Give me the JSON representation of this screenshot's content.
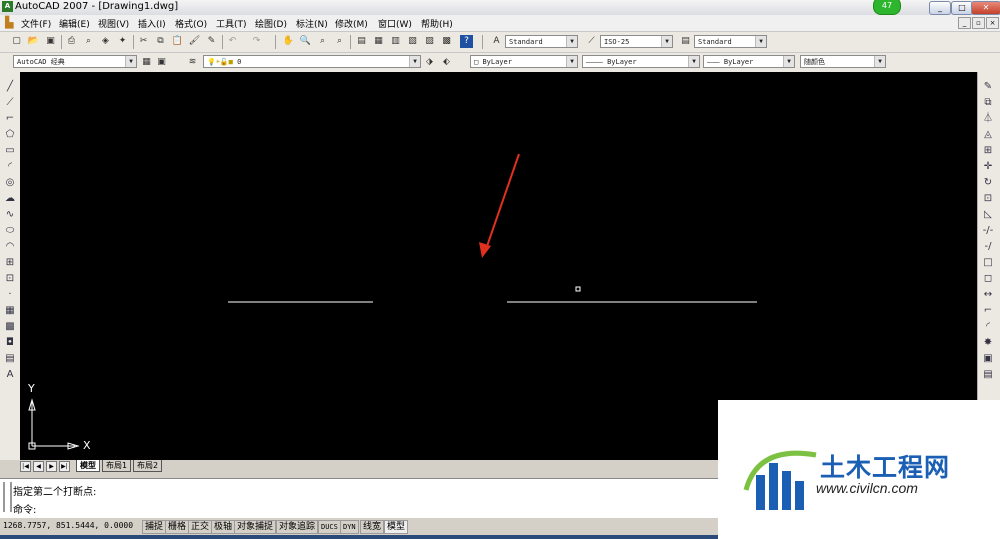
{
  "window": {
    "title": "AutoCAD 2007 - [Drawing1.dwg]",
    "app_icon_label": "A",
    "badge": "47",
    "controls": [
      "_",
      "□",
      "✕"
    ],
    "mdi_controls": [
      "_",
      "▫",
      "×"
    ]
  },
  "menu": [
    "文件(F)",
    "编辑(E)",
    "视图(V)",
    "插入(I)",
    "格式(O)",
    "工具(T)",
    "绘图(D)",
    "标注(N)",
    "修改(M)",
    "窗口(W)",
    "帮助(H)"
  ],
  "toolbar1": {
    "text_style": "Standard",
    "dim_style": "ISO-25",
    "table_style": "Standard"
  },
  "toolbar2": {
    "workspace": "AutoCAD 经典",
    "layer": "0",
    "color": "ByLayer",
    "linetype": "ByLayer",
    "lineweight": "ByLayer",
    "plotstyle": "随颜色"
  },
  "left_tools": [
    "line-icon",
    "construction-line-icon",
    "polyline-icon",
    "polygon-icon",
    "rectangle-icon",
    "arc-icon",
    "circle-icon",
    "revision-cloud-icon",
    "spline-icon",
    "ellipse-icon",
    "ellipse-arc-icon",
    "insert-block-icon",
    "make-block-icon",
    "point-icon",
    "hatch-icon",
    "gradient-icon",
    "region-icon",
    "table-icon",
    "multiline-text-icon"
  ],
  "left_tool_glyphs": [
    "╱",
    "⟋",
    "⌐",
    "⬠",
    "▭",
    "◜",
    "◎",
    "☁",
    "∿",
    "⬭",
    "◠",
    "⊞",
    "⊡",
    "·",
    "▦",
    "▩",
    "◘",
    "▤",
    "A"
  ],
  "right_tools": [
    "erase-icon",
    "copy-icon",
    "mirror-icon",
    "offset-icon",
    "array-icon",
    "move-icon",
    "rotate-icon",
    "scale-icon",
    "stretch-icon",
    "trim-icon",
    "extend-icon",
    "break-at-point-icon",
    "break-icon",
    "join-icon",
    "chamfer-icon",
    "fillet-icon",
    "explode-icon",
    "draworder-icon",
    "draworder-back-icon"
  ],
  "right_tool_glyphs": [
    "✎",
    "⧉",
    "⏃",
    "◬",
    "⊞",
    "✛",
    "↻",
    "⊡",
    "◺",
    "-/-",
    "-/",
    "□",
    "◻",
    "↔",
    "⌐",
    "◜",
    "✸",
    "▣",
    "▤"
  ],
  "ucs": {
    "x_label": "X",
    "y_label": "Y"
  },
  "layout_nav": [
    "|◀",
    "◀",
    "▶",
    "▶|"
  ],
  "layout_tabs": [
    "模型",
    "布局1",
    "布局2"
  ],
  "active_layout": "模型",
  "command": {
    "history": "指定第二个打断点:",
    "prompt": "命令:"
  },
  "status": {
    "coords": "1268.7757, 851.5444, 0.0000",
    "toggles": [
      "捕捉",
      "栅格",
      "正交",
      "极轴",
      "对象捕捉",
      "对象追踪",
      "DUCS",
      "DYN",
      "线宽",
      "模型"
    ]
  },
  "watermark": {
    "name": "土木工程网",
    "url": "www.civilcn.com"
  },
  "colors": {
    "canvas": "#000000",
    "drawing_line": "#ffffff",
    "arrow": "#e03020",
    "watermark_blue": "#1a5fb4",
    "watermark_green": "#7cc142"
  }
}
